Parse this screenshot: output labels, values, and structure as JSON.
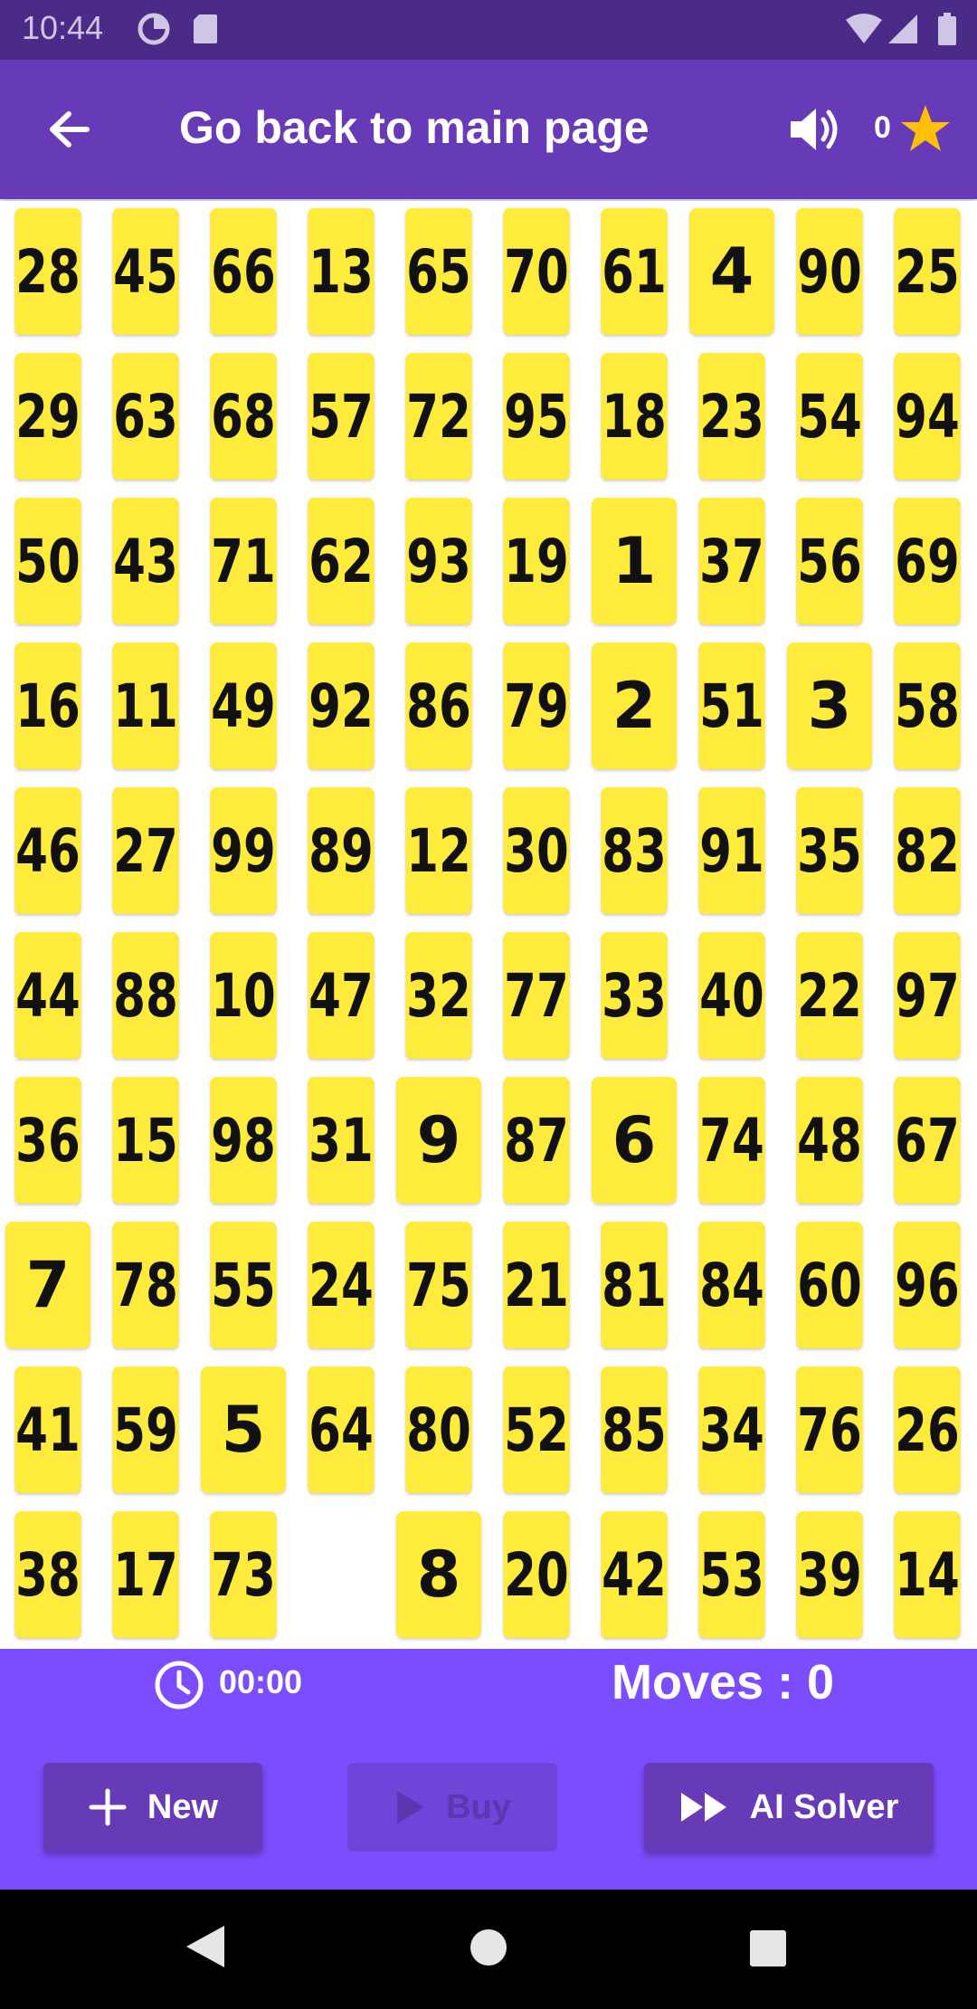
{
  "status_bar": {
    "time": "10:44",
    "icons": [
      "data-saver-icon",
      "sd-card-icon",
      "wifi-icon",
      "signal-icon",
      "battery-icon"
    ]
  },
  "app_bar": {
    "title": "Go back to main page",
    "star_count": "0",
    "icons": [
      "back-arrow-icon",
      "volume-icon",
      "star-icon"
    ]
  },
  "colors": {
    "status_bar": "#4a2b87",
    "app_bar": "#673ab7",
    "tile": "#ffeb3b",
    "bottom_panel": "#7c4dff",
    "button": "#673ab7",
    "star": "#ffc107"
  },
  "board": {
    "rows": [
      [
        "28",
        "45",
        "66",
        "13",
        "65",
        "70",
        "61",
        "4",
        "90",
        "25"
      ],
      [
        "29",
        "63",
        "68",
        "57",
        "72",
        "95",
        "18",
        "23",
        "54",
        "94"
      ],
      [
        "50",
        "43",
        "71",
        "62",
        "93",
        "19",
        "1",
        "37",
        "56",
        "69"
      ],
      [
        "16",
        "11",
        "49",
        "92",
        "86",
        "79",
        "2",
        "51",
        "3",
        "58"
      ],
      [
        "46",
        "27",
        "99",
        "89",
        "12",
        "30",
        "83",
        "91",
        "35",
        "82"
      ],
      [
        "44",
        "88",
        "10",
        "47",
        "32",
        "77",
        "33",
        "40",
        "22",
        "97"
      ],
      [
        "36",
        "15",
        "98",
        "31",
        "9",
        "87",
        "6",
        "74",
        "48",
        "67"
      ],
      [
        "7",
        "78",
        "55",
        "24",
        "75",
        "21",
        "81",
        "84",
        "60",
        "96"
      ],
      [
        "41",
        "59",
        "5",
        "64",
        "80",
        "52",
        "85",
        "34",
        "76",
        "26"
      ],
      [
        "38",
        "17",
        "73",
        "",
        "8",
        "20",
        "42",
        "53",
        "39",
        "14"
      ]
    ]
  },
  "bottom": {
    "timer": "00:00",
    "moves": "Moves : 0",
    "buttons": {
      "new": "New",
      "buy": "Buy",
      "ai_solver": "AI Solver"
    }
  }
}
